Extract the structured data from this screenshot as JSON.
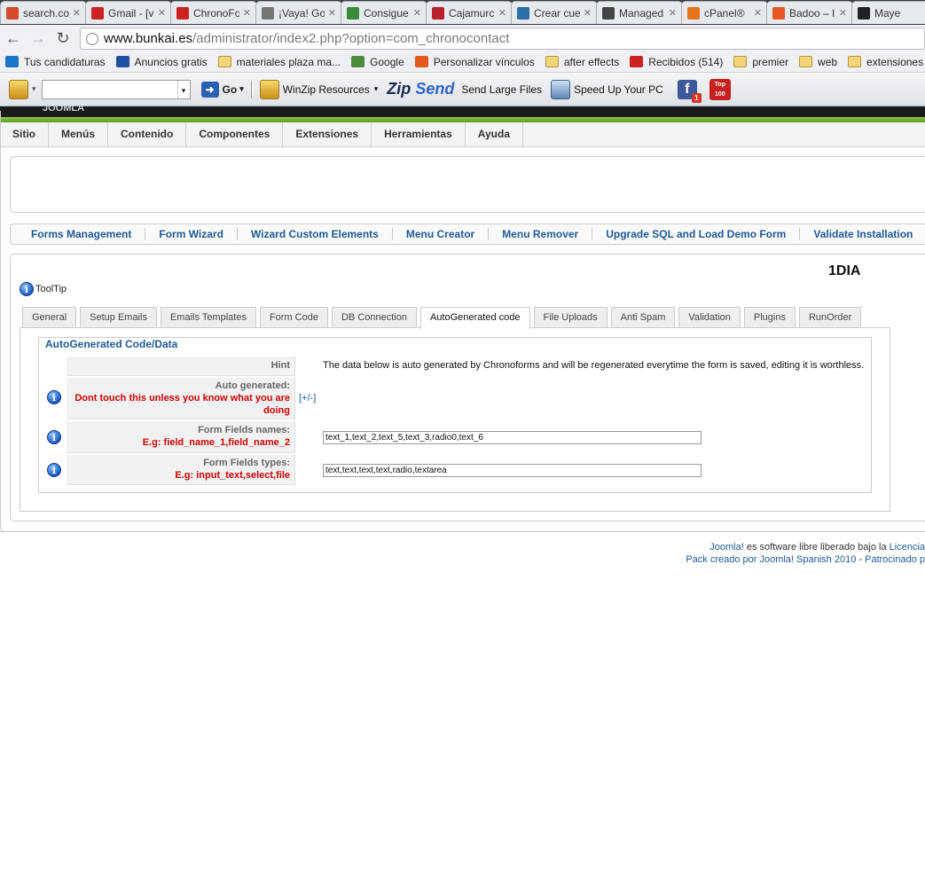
{
  "browser": {
    "tabs": [
      {
        "title": "search.co",
        "icon": "search-icon",
        "color": "#d84a2c"
      },
      {
        "title": "Gmail - [v",
        "icon": "gmail-icon",
        "color": "#cc2222"
      },
      {
        "title": "ChronoFo",
        "icon": "chronoforms-icon",
        "color": "#cc2222"
      },
      {
        "title": "¡Vaya! Go",
        "icon": "globe-icon",
        "color": "#777777"
      },
      {
        "title": "Consigue",
        "icon": "chrome-icon",
        "color": "#3a8a3a"
      },
      {
        "title": "Cajamurc",
        "icon": "bank-icon",
        "color": "#b8202a"
      },
      {
        "title": "Crear cue",
        "icon": "wordpress-icon",
        "color": "#2a6fa8"
      },
      {
        "title": "Managed",
        "icon": "spinner-icon",
        "color": "#444444"
      },
      {
        "title": "cPanel®",
        "icon": "cpanel-icon",
        "color": "#e8721c"
      },
      {
        "title": "Badoo – I",
        "icon": "badoo-icon",
        "color": "#e85525"
      },
      {
        "title": "Maye",
        "icon": "joomla-icon",
        "color": "#222222"
      }
    ],
    "url_host": "www.bunkai.es",
    "url_path": "/administrator/index2.php?option=com_chronocontact",
    "bookmarks": [
      {
        "label": "Tus candidaturas",
        "icon": "infojobs-icon"
      },
      {
        "label": "Anuncios gratis",
        "icon": "classifieds-icon"
      },
      {
        "label": "materiales plaza ma...",
        "icon": "folder-icon"
      },
      {
        "label": "Google",
        "icon": "google-icon"
      },
      {
        "label": "Personalizar vínculos",
        "icon": "windows-icon"
      },
      {
        "label": "after effects",
        "icon": "folder-icon"
      },
      {
        "label": "Recibidos (514)",
        "icon": "gmail-icon"
      },
      {
        "label": "premier",
        "icon": "folder-icon"
      },
      {
        "label": "web",
        "icon": "folder-icon"
      },
      {
        "label": "extensiones joo",
        "icon": "folder-icon"
      }
    ],
    "toolbar": {
      "go_label": "Go",
      "winzip_label": "WinZip Resources",
      "zipsend_label_a": "Zip",
      "zipsend_label_b": "Send",
      "send_large_label": "Send Large Files",
      "speed_label": "Speed Up Your PC",
      "fb_badge": "1",
      "top_label": "Top 100"
    }
  },
  "joomla": {
    "logo_text": "JOOMLA",
    "menu": [
      "Sitio",
      "Menús",
      "Contenido",
      "Componentes",
      "Extensiones",
      "Herramientas",
      "Ayuda"
    ],
    "submenu": [
      "Forms Management",
      "Form Wizard",
      "Wizard Custom Elements",
      "Menu Creator",
      "Menu Remover",
      "Upgrade SQL and Load Demo Form",
      "Validate Installation"
    ],
    "form_title": "1DIA",
    "tooltip_label": "ToolTip",
    "tabs": [
      "General",
      "Setup Emails",
      "Emails Templates",
      "Form Code",
      "DB Connection",
      "AutoGenerated code",
      "File Uploads",
      "Anti Spam",
      "Validation",
      "Plugins",
      "RunOrder"
    ],
    "active_tab": "AutoGenerated code",
    "fieldset_legend": "AutoGenerated Code/Data",
    "rows": {
      "hint_label": "Hint",
      "hint_text": "The data below is auto generated by Chronoforms and will be regenerated everytime the form is saved, editing it is worthless.",
      "auto_label": "Auto generated:",
      "auto_warning": "Dont touch this unless you know what you are doing",
      "toggle": "[+/-]",
      "names_label": "Form Fields names:",
      "names_example": "E.g: field_name_1,field_name_2",
      "names_value": "text_1,text_2,text_5,text_3,radio0,text_6",
      "types_label": "Form Fields types:",
      "types_example": "E.g: input_text,select,file",
      "types_value": "text,text,text,text,radio,textarea"
    },
    "footer": {
      "joomla_link": "Joomla!",
      "line1_text": " es software libre liberado bajo la ",
      "license_link": "Licencia",
      "line2_link": "Pack creado por Joomla! Spanish 2010",
      "line2_sep": " - ",
      "line2_link2": "Patrocinado p"
    }
  }
}
